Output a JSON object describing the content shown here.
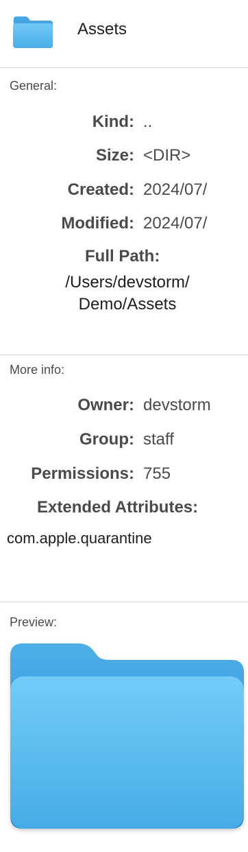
{
  "header": {
    "icon": "folder-icon",
    "title": "Assets"
  },
  "general": {
    "title": "General:",
    "kind": {
      "label": "Kind:",
      "value": ".."
    },
    "size": {
      "label": "Size:",
      "value": "<DIR>"
    },
    "created": {
      "label": "Created:",
      "value": "2024/07/"
    },
    "modified": {
      "label": "Modified:",
      "value": "2024/07/"
    },
    "full_path": {
      "label": "Full Path:",
      "line1": "/Users/devstorm/",
      "line2": "Demo/Assets"
    }
  },
  "more_info": {
    "title": "More info:",
    "owner": {
      "label": "Owner:",
      "value": "devstorm"
    },
    "group": {
      "label": "Group:",
      "value": "staff"
    },
    "permissions": {
      "label": "Permissions:",
      "value": "755"
    },
    "extended_attributes": {
      "label": "Extended Attributes:",
      "value": "com.apple.quarantine"
    }
  },
  "preview": {
    "title": "Preview:",
    "icon": "folder-icon"
  },
  "colors": {
    "folder_front": "#5ab8ee",
    "folder_back": "#3a9fde",
    "divider": "#d6d6d6"
  }
}
